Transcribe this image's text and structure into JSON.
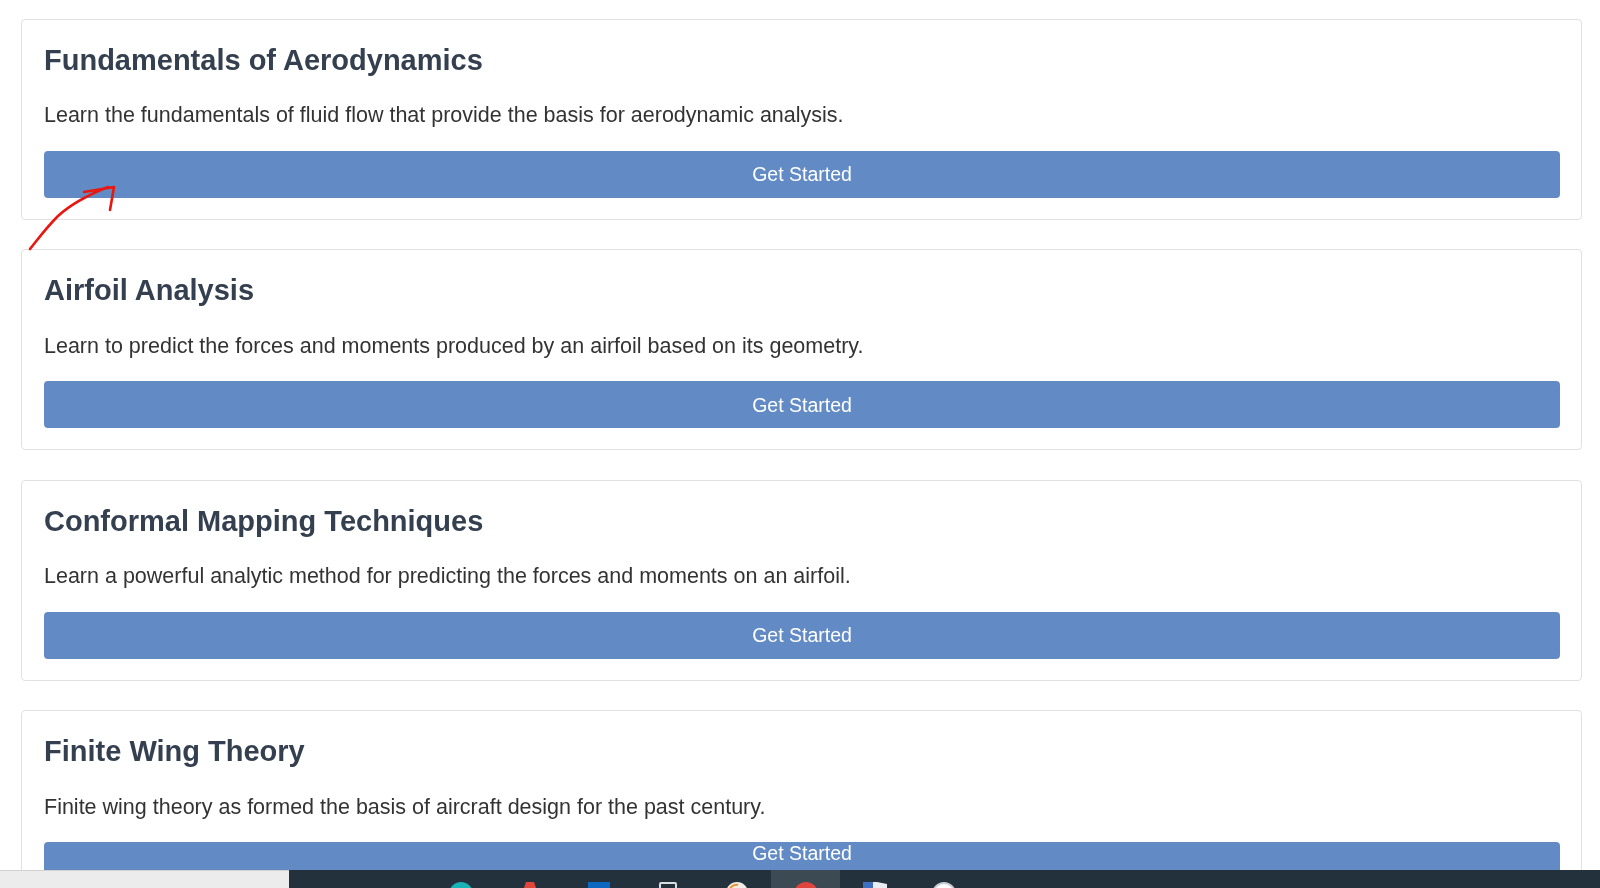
{
  "courses": [
    {
      "title": "Fundamentals of Aerodynamics",
      "description": "Learn the fundamentals of fluid flow that provide the basis for aerodynamic analysis.",
      "button": "Get Started"
    },
    {
      "title": "Airfoil Analysis",
      "description": "Learn to predict the forces and moments produced by an airfoil based on its geometry.",
      "button": "Get Started"
    },
    {
      "title": "Conformal Mapping Techniques",
      "description": "Learn a powerful analytic method for predicting the forces and moments on an airfoil.",
      "button": "Get Started"
    },
    {
      "title": "Finite Wing Theory",
      "description": "Finite wing theory as formed the basis of aircraft design for the past century.",
      "button": "Get Started"
    }
  ],
  "annotation": {
    "kind": "arrow"
  },
  "taskbar": {
    "apps": [
      {
        "kind": "globe",
        "selected": false
      },
      {
        "kind": "marker",
        "selected": false
      },
      {
        "kind": "tile",
        "selected": false
      },
      {
        "kind": "device",
        "selected": false
      },
      {
        "kind": "disc",
        "selected": false
      },
      {
        "kind": "dot",
        "selected": true
      },
      {
        "kind": "flag",
        "selected": false
      },
      {
        "kind": "ring",
        "selected": false
      }
    ]
  }
}
